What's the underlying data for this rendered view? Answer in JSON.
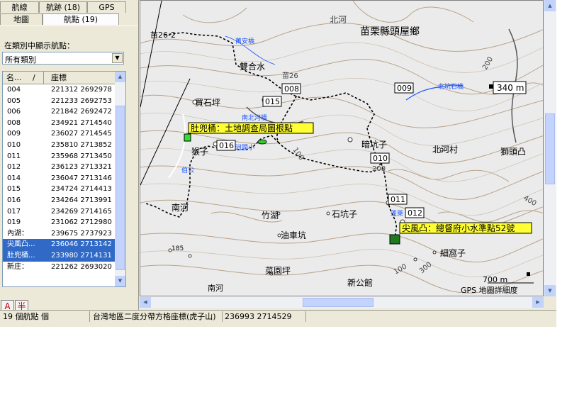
{
  "tabs": {
    "row1": [
      "航線",
      "航跡 (18)",
      "GPS"
    ],
    "row2": [
      "地圖",
      "航點 (19)"
    ]
  },
  "category": {
    "label": "在類別中顯示航點：",
    "selected": "所有類別"
  },
  "waypoint_list": {
    "columns": [
      "名...",
      "座標"
    ],
    "sort_mark": "/",
    "rows": [
      {
        "name": "004",
        "coord": "221312 2692978"
      },
      {
        "name": "005",
        "coord": "221233 2692753"
      },
      {
        "name": "006",
        "coord": "221842 2692472"
      },
      {
        "name": "008",
        "coord": "234921 2714540"
      },
      {
        "name": "009",
        "coord": "236027 2714545"
      },
      {
        "name": "010",
        "coord": "235810 2713852"
      },
      {
        "name": "011",
        "coord": "235968 2713450"
      },
      {
        "name": "012",
        "coord": "236123 2713321"
      },
      {
        "name": "014",
        "coord": "236047 2713146"
      },
      {
        "name": "015",
        "coord": "234724 2714413"
      },
      {
        "name": "016",
        "coord": "234264 2713991"
      },
      {
        "name": "017",
        "coord": "234269 2714165"
      },
      {
        "name": "019",
        "coord": "231062 2712980"
      },
      {
        "name": "內湖：",
        "coord": "239675 2737923"
      },
      {
        "name": "尖風凸...",
        "coord": "236046 2713142"
      },
      {
        "name": "肚兜桶...",
        "coord": "233980 2714131"
      },
      {
        "name": "新庄：",
        "coord": "221262 2693020"
      }
    ]
  },
  "toolbar_icons": [
    {
      "name": "text-tool-icon",
      "glyph": "A"
    },
    {
      "name": "font-tool-icon",
      "glyph": "半"
    }
  ],
  "map": {
    "labels": {
      "north_river": "北河",
      "township": "苗栗縣頭屋鄉",
      "road_miao262": "苗26-2",
      "road_miao26": "苗26",
      "wanan_bridge": "萬安橋",
      "shuanghe": "雙合水",
      "maishiping": "買石坪",
      "nanbei_bridge": "南北河橋",
      "bridge_waynote": "北坑石橋",
      "houzi": "猴子",
      "river_school": "河國小",
      "bogong": "伯公",
      "nanhe": "南河",
      "zhuhu": "竹湖",
      "shikengzi": "石坑子",
      "youchekeng": "油車坑",
      "caiyuanping": "菜園坪",
      "xingongguan": "新公館",
      "anhengzi": "暗坑子",
      "beihecun": "北河村",
      "shitoutu": "獅頭凸",
      "xiwozi": "細窩子",
      "nanhe_bottom": "南河",
      "wayhe": "蓬萊",
      "elev340": "340 m",
      "elev185": "185",
      "scale": "700 m",
      "map_detail": "GPS 地圖詳細度",
      "c100": "100",
      "c200a": "200",
      "c200b": "200",
      "c300": "300",
      "c400": "400",
      "c100b": "100"
    },
    "waypoints": {
      "wp008": "008",
      "wp009": "009",
      "wp010": "010",
      "wp011": "011",
      "wp012": "012",
      "wp015": "015",
      "wp016": "016"
    },
    "callouts": {
      "dudoutong": "肚兜桶：土地調查局圖根點",
      "jianfengtu": "尖風凸：總督府小水準點52號"
    },
    "colors": {
      "callout_bg": "#ffff33",
      "marker_green": "#1f7a1f",
      "marker_lime": "#33dd33",
      "river": "#1a52ff",
      "contour": "#b9a38a"
    }
  },
  "status_bar": {
    "count": "19 個航點 個",
    "grid": "台灣地區二度分帶方格座標(虎子山)",
    "coords": "236993 2714529"
  }
}
